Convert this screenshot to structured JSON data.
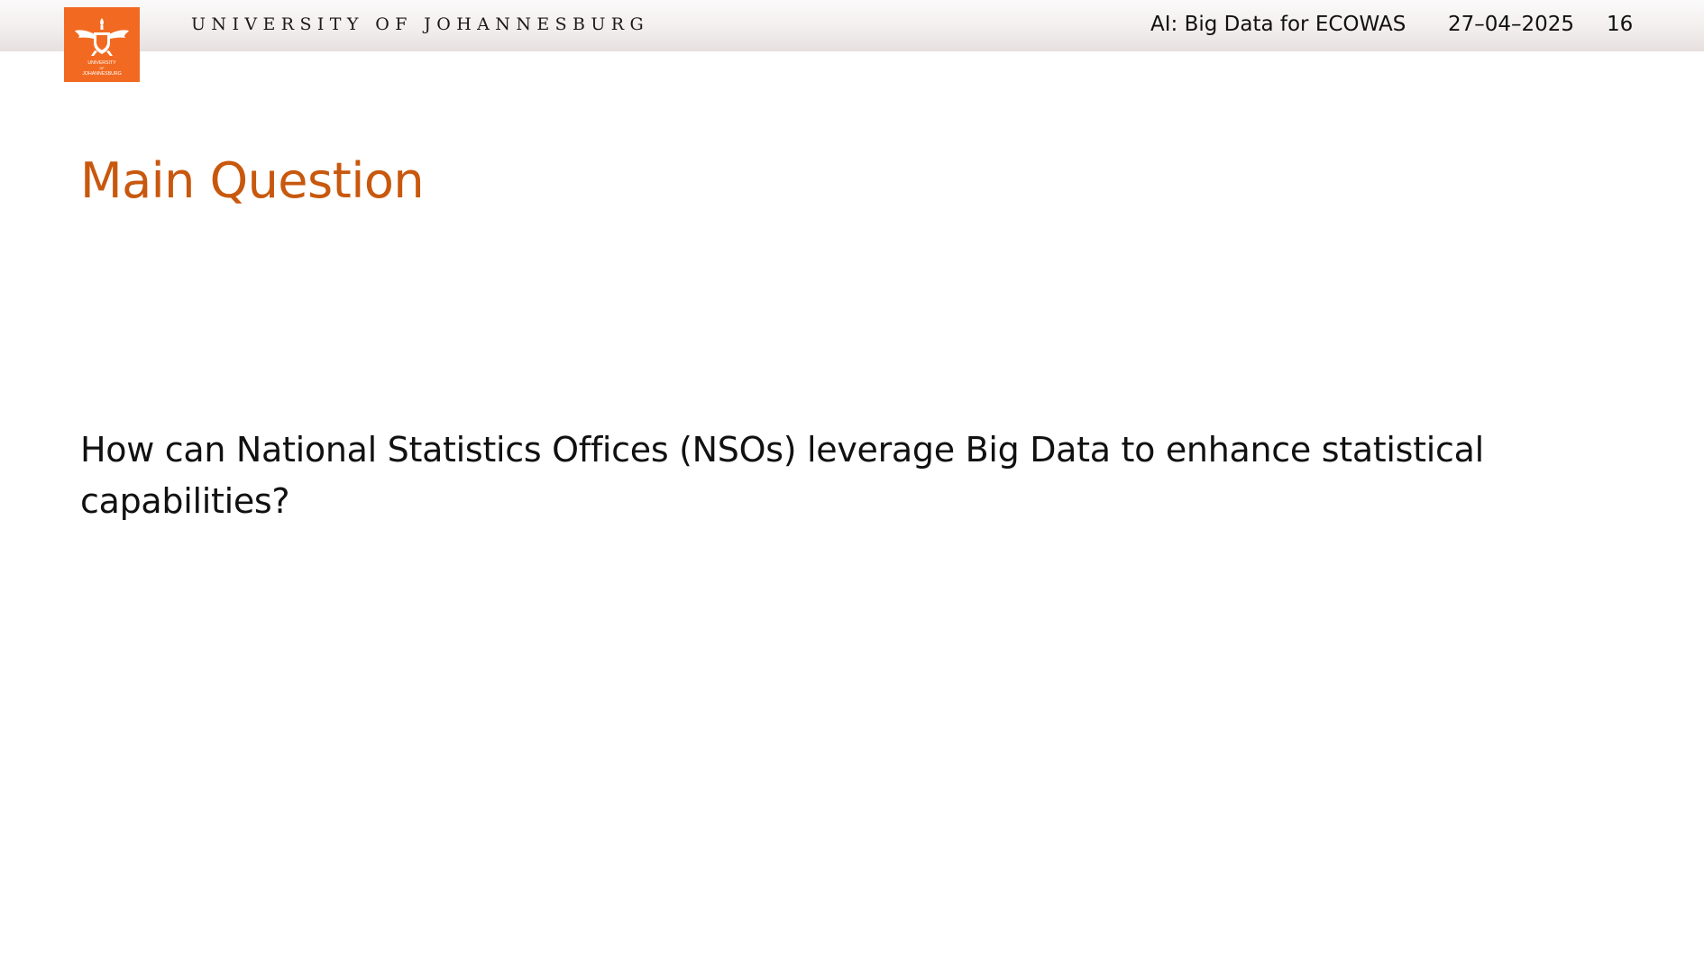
{
  "header": {
    "university_name": "UNIVERSITY OF JOHANNESBURG",
    "talk_title": "AI: Big Data for ECOWAS",
    "date": "27–04–2025",
    "page_number": "16",
    "logo": {
      "icon": "university-crest-icon",
      "line1": "UNIVERSITY",
      "line2": "OF",
      "line3": "JOHANNESBURG",
      "background": "#f26a22"
    }
  },
  "slide": {
    "title": "Main Question",
    "title_color": "#c8580e",
    "question": "How can National Statistics Offices (NSOs) leverage Big Data to enhance statistical capabilities?"
  }
}
